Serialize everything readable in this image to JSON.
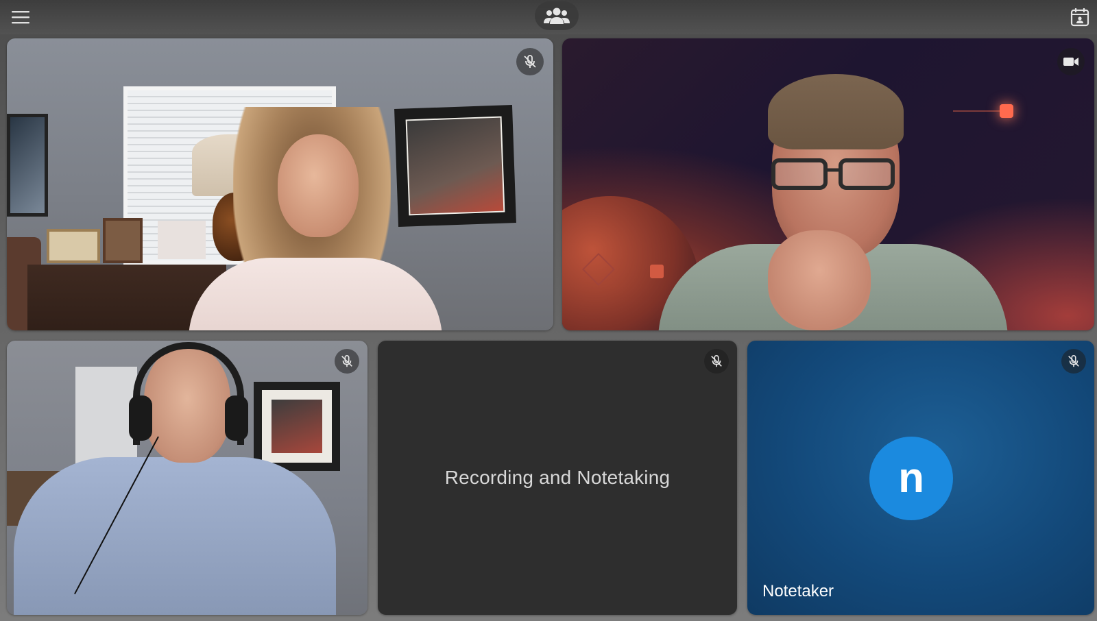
{
  "app": {
    "top_bar": {
      "menu_icon": "hamburger-menu-icon",
      "participants_icon": "people-group-icon",
      "calendar_icon": "calendar-icon"
    }
  },
  "tiles": [
    {
      "id": "participant-1",
      "type": "video",
      "status_icon": "microphone-muted-icon"
    },
    {
      "id": "participant-2",
      "type": "video",
      "status_icon": "video-camera-icon"
    },
    {
      "id": "participant-3",
      "type": "video",
      "status_icon": "microphone-muted-icon"
    },
    {
      "id": "participant-4",
      "type": "placeholder",
      "label": "Recording and Notetaking",
      "status_icon": "microphone-muted-icon"
    },
    {
      "id": "participant-5",
      "type": "avatar",
      "avatar_letter": "n",
      "name": "Notetaker",
      "status_icon": "microphone-muted-icon"
    }
  ],
  "colors": {
    "avatar_bg": "#1b8adf",
    "tile_placeholder_bg": "#2e2e2e",
    "notetaker_tile_bg": "#13497a",
    "app_bg": "#5c5c5c"
  }
}
